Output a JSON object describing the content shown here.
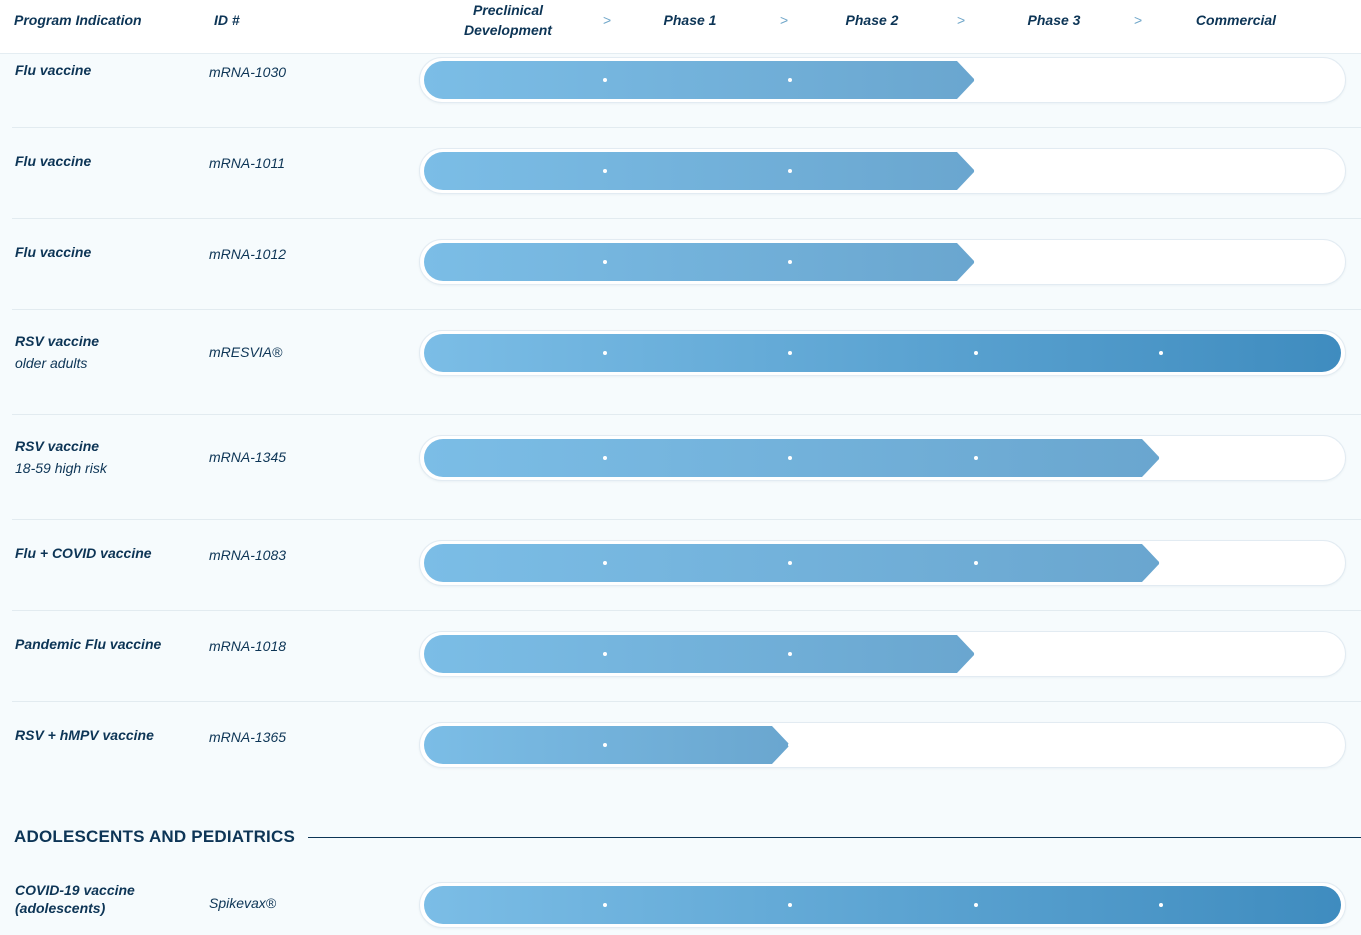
{
  "header": {
    "program_indication": "Program Indication",
    "id": "ID #",
    "stages": [
      {
        "line1": "Preclinical",
        "line2": "Development"
      },
      {
        "line1": "Phase 1",
        "line2": ""
      },
      {
        "line1": "Phase 2",
        "line2": ""
      },
      {
        "line1": "Phase 3",
        "line2": ""
      },
      {
        "line1": "Commercial",
        "line2": ""
      }
    ],
    "separator_glyph": ">"
  },
  "programs": [
    {
      "name": "Flu vaccine",
      "sub": "",
      "id": "mRNA-1030",
      "stage_reached": 3
    },
    {
      "name": "Flu vaccine",
      "sub": "",
      "id": "mRNA-1011",
      "stage_reached": 3
    },
    {
      "name": "Flu vaccine",
      "sub": "",
      "id": "mRNA-1012",
      "stage_reached": 3
    },
    {
      "name": "RSV vaccine",
      "sub": "older adults",
      "id": "mRESVIA®",
      "stage_reached": 5
    },
    {
      "name": "RSV vaccine",
      "sub": "18-59 high risk",
      "id": "mRNA-1345",
      "stage_reached": 4
    },
    {
      "name": "Flu + COVID vaccine",
      "sub": "",
      "id": "mRNA-1083",
      "stage_reached": 4
    },
    {
      "name": "Pandemic Flu vaccine",
      "sub": "",
      "id": "mRNA-1018",
      "stage_reached": 3
    },
    {
      "name": "RSV + hMPV vaccine",
      "sub": "",
      "id": "mRNA-1365",
      "stage_reached": 2
    }
  ],
  "section": {
    "title": "ADOLESCENTS AND PEDIATRICS",
    "programs": [
      {
        "name": "COVID-19 vaccine",
        "name2": "(adolescents)",
        "id": "Spikevax®",
        "stage_reached": 5
      }
    ]
  },
  "colors": {
    "bar_start": "#7bbde6",
    "bar_mid": "#6aa6cf",
    "bar_end_complete": "#3f8cbf",
    "text": "#0d3556",
    "separator": "#6fa6c9"
  }
}
